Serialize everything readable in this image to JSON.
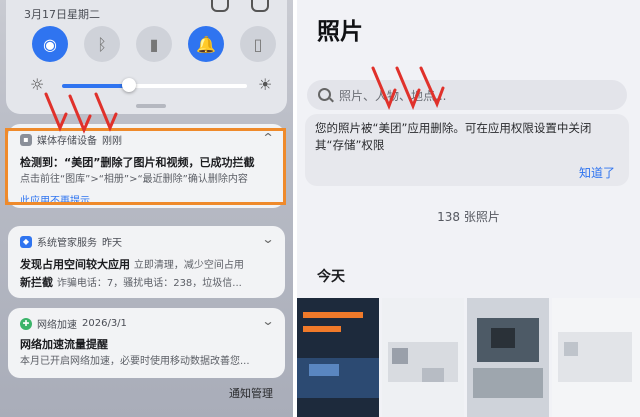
{
  "left": {
    "quick_settings": {
      "date": "3月17日星期二",
      "toggles": [
        {
          "icon": "wifi-icon",
          "glyph": "◉",
          "on": true
        },
        {
          "icon": "bluetooth-icon",
          "glyph": "ᛒ",
          "on": false
        },
        {
          "icon": "flashlight-icon",
          "glyph": "▮",
          "on": false
        },
        {
          "icon": "bell-icon",
          "glyph": "🔔",
          "on": true
        },
        {
          "icon": "vibrate-icon",
          "glyph": "▯",
          "on": false
        }
      ],
      "brightness_level": 0.36,
      "sun_low": "☼",
      "sun_high": "☀"
    },
    "notifications": [
      {
        "app": "媒体存储设备",
        "time": "刚刚",
        "title": "检测到：“美团”删除了图片和视频，已成功拦截",
        "body": "点击前往“图库”>“相册”>“最近删除”确认删除内容",
        "link": "此应用不再提示"
      },
      {
        "app": "系统管家服务",
        "time": "昨天",
        "title": "发现占用空间较大应用",
        "title_tail": "立即清理，减少空间占用",
        "title2": "新拦截",
        "body2": "诈骗电话：7，骚扰电话：238，垃圾信..."
      },
      {
        "app": "网络加速",
        "time": "2026/3/1",
        "title": "网络加速流量提醒",
        "body": "本月已开启网络加速，必要时使用移动数据改善您..."
      }
    ],
    "notif_manage": "通知管理"
  },
  "right": {
    "title": "照片",
    "search_placeholder": "照片、人物、地点...",
    "banner_text": "您的照片被“美团”应用删除。可在应用权限设置中关闭其“存储”权限",
    "banner_ok": "知道了",
    "count": "138 张照片",
    "today": "今天"
  },
  "colors": {
    "accent": "#2f74f0",
    "highlight": "#ef8a2b",
    "scribble": "#e0312b"
  }
}
